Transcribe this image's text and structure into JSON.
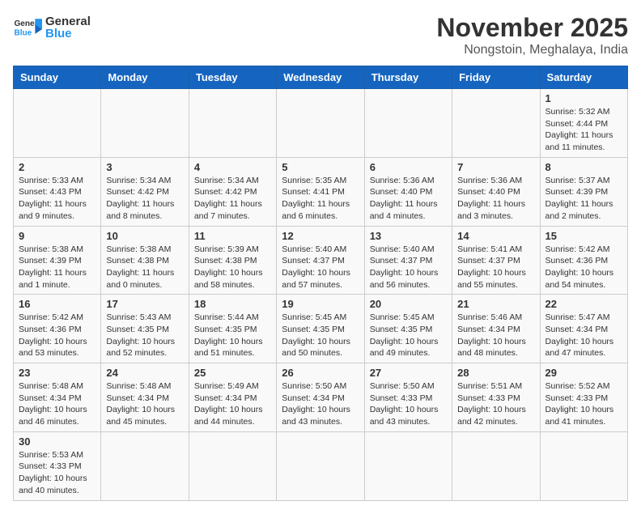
{
  "header": {
    "logo_general": "General",
    "logo_blue": "Blue",
    "month_title": "November 2025",
    "location": "Nongstoin, Meghalaya, India"
  },
  "days_of_week": [
    "Sunday",
    "Monday",
    "Tuesday",
    "Wednesday",
    "Thursday",
    "Friday",
    "Saturday"
  ],
  "weeks": [
    [
      {
        "day": "",
        "info": ""
      },
      {
        "day": "",
        "info": ""
      },
      {
        "day": "",
        "info": ""
      },
      {
        "day": "",
        "info": ""
      },
      {
        "day": "",
        "info": ""
      },
      {
        "day": "",
        "info": ""
      },
      {
        "day": "1",
        "info": "Sunrise: 5:32 AM\nSunset: 4:44 PM\nDaylight: 11 hours and 11 minutes."
      }
    ],
    [
      {
        "day": "2",
        "info": "Sunrise: 5:33 AM\nSunset: 4:43 PM\nDaylight: 11 hours and 9 minutes."
      },
      {
        "day": "3",
        "info": "Sunrise: 5:34 AM\nSunset: 4:42 PM\nDaylight: 11 hours and 8 minutes."
      },
      {
        "day": "4",
        "info": "Sunrise: 5:34 AM\nSunset: 4:42 PM\nDaylight: 11 hours and 7 minutes."
      },
      {
        "day": "5",
        "info": "Sunrise: 5:35 AM\nSunset: 4:41 PM\nDaylight: 11 hours and 6 minutes."
      },
      {
        "day": "6",
        "info": "Sunrise: 5:36 AM\nSunset: 4:40 PM\nDaylight: 11 hours and 4 minutes."
      },
      {
        "day": "7",
        "info": "Sunrise: 5:36 AM\nSunset: 4:40 PM\nDaylight: 11 hours and 3 minutes."
      },
      {
        "day": "8",
        "info": "Sunrise: 5:37 AM\nSunset: 4:39 PM\nDaylight: 11 hours and 2 minutes."
      }
    ],
    [
      {
        "day": "9",
        "info": "Sunrise: 5:38 AM\nSunset: 4:39 PM\nDaylight: 11 hours and 1 minute."
      },
      {
        "day": "10",
        "info": "Sunrise: 5:38 AM\nSunset: 4:38 PM\nDaylight: 11 hours and 0 minutes."
      },
      {
        "day": "11",
        "info": "Sunrise: 5:39 AM\nSunset: 4:38 PM\nDaylight: 10 hours and 58 minutes."
      },
      {
        "day": "12",
        "info": "Sunrise: 5:40 AM\nSunset: 4:37 PM\nDaylight: 10 hours and 57 minutes."
      },
      {
        "day": "13",
        "info": "Sunrise: 5:40 AM\nSunset: 4:37 PM\nDaylight: 10 hours and 56 minutes."
      },
      {
        "day": "14",
        "info": "Sunrise: 5:41 AM\nSunset: 4:37 PM\nDaylight: 10 hours and 55 minutes."
      },
      {
        "day": "15",
        "info": "Sunrise: 5:42 AM\nSunset: 4:36 PM\nDaylight: 10 hours and 54 minutes."
      }
    ],
    [
      {
        "day": "16",
        "info": "Sunrise: 5:42 AM\nSunset: 4:36 PM\nDaylight: 10 hours and 53 minutes."
      },
      {
        "day": "17",
        "info": "Sunrise: 5:43 AM\nSunset: 4:35 PM\nDaylight: 10 hours and 52 minutes."
      },
      {
        "day": "18",
        "info": "Sunrise: 5:44 AM\nSunset: 4:35 PM\nDaylight: 10 hours and 51 minutes."
      },
      {
        "day": "19",
        "info": "Sunrise: 5:45 AM\nSunset: 4:35 PM\nDaylight: 10 hours and 50 minutes."
      },
      {
        "day": "20",
        "info": "Sunrise: 5:45 AM\nSunset: 4:35 PM\nDaylight: 10 hours and 49 minutes."
      },
      {
        "day": "21",
        "info": "Sunrise: 5:46 AM\nSunset: 4:34 PM\nDaylight: 10 hours and 48 minutes."
      },
      {
        "day": "22",
        "info": "Sunrise: 5:47 AM\nSunset: 4:34 PM\nDaylight: 10 hours and 47 minutes."
      }
    ],
    [
      {
        "day": "23",
        "info": "Sunrise: 5:48 AM\nSunset: 4:34 PM\nDaylight: 10 hours and 46 minutes."
      },
      {
        "day": "24",
        "info": "Sunrise: 5:48 AM\nSunset: 4:34 PM\nDaylight: 10 hours and 45 minutes."
      },
      {
        "day": "25",
        "info": "Sunrise: 5:49 AM\nSunset: 4:34 PM\nDaylight: 10 hours and 44 minutes."
      },
      {
        "day": "26",
        "info": "Sunrise: 5:50 AM\nSunset: 4:34 PM\nDaylight: 10 hours and 43 minutes."
      },
      {
        "day": "27",
        "info": "Sunrise: 5:50 AM\nSunset: 4:33 PM\nDaylight: 10 hours and 43 minutes."
      },
      {
        "day": "28",
        "info": "Sunrise: 5:51 AM\nSunset: 4:33 PM\nDaylight: 10 hours and 42 minutes."
      },
      {
        "day": "29",
        "info": "Sunrise: 5:52 AM\nSunset: 4:33 PM\nDaylight: 10 hours and 41 minutes."
      }
    ],
    [
      {
        "day": "30",
        "info": "Sunrise: 5:53 AM\nSunset: 4:33 PM\nDaylight: 10 hours and 40 minutes."
      },
      {
        "day": "",
        "info": ""
      },
      {
        "day": "",
        "info": ""
      },
      {
        "day": "",
        "info": ""
      },
      {
        "day": "",
        "info": ""
      },
      {
        "day": "",
        "info": ""
      },
      {
        "day": "",
        "info": ""
      }
    ]
  ]
}
